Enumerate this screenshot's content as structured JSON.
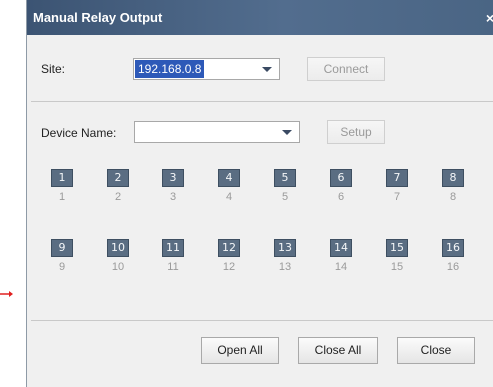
{
  "dialog": {
    "title": "Manual Relay Output",
    "close_glyph": "×"
  },
  "site": {
    "label": "Site:",
    "value": "192.168.0.8",
    "connect_label": "Connect"
  },
  "device": {
    "label": "Device Name:",
    "value": "",
    "setup_label": "Setup"
  },
  "relays": {
    "row1": [
      "1",
      "2",
      "3",
      "4",
      "5",
      "6",
      "7",
      "8"
    ],
    "row2": [
      "9",
      "10",
      "11",
      "12",
      "13",
      "14",
      "15",
      "16"
    ]
  },
  "footer": {
    "open_all": "Open All",
    "close_all": "Close All",
    "close": "Close"
  },
  "colors": {
    "title_bar": "#3c5473",
    "relay_box": "#5a6d82",
    "pointer_arrow": "#e02020"
  }
}
